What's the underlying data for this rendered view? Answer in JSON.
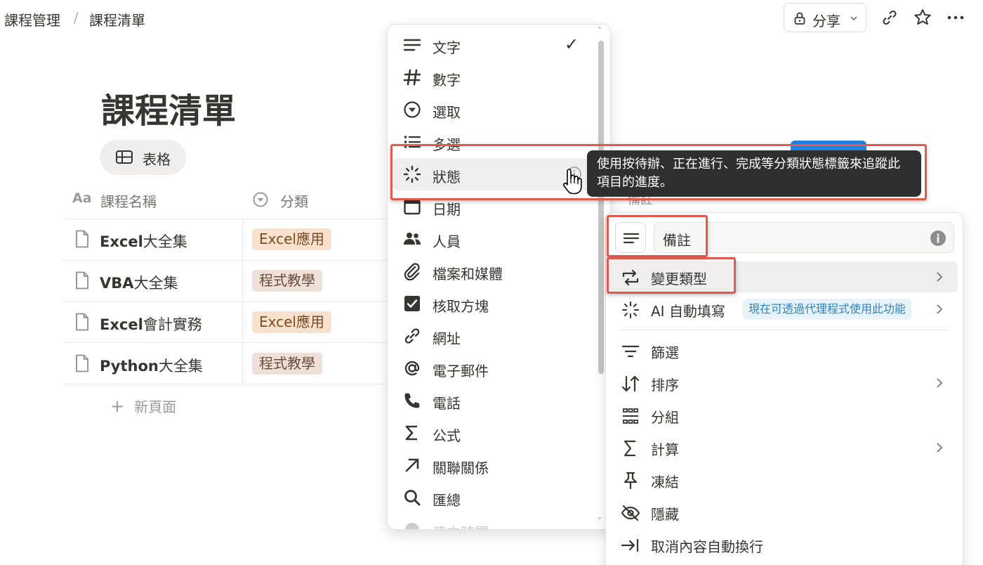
{
  "breadcrumb": {
    "parent": "課程管理",
    "separator": "/",
    "current": "課程清單"
  },
  "topbar": {
    "share_label": "分享",
    "icons": [
      "lock-icon",
      "chevron-down-icon",
      "link-icon",
      "star-icon",
      "more-icon"
    ]
  },
  "page": {
    "title": "課程清單",
    "view_tab": "表格",
    "columns": {
      "name_icon": "Aa",
      "name": "課程名稱",
      "category": "分類"
    },
    "rows": [
      {
        "name_bold": "Excel",
        "name_rest": "大全集",
        "tag": "Excel應用",
        "tag_color": "#f9e2cd"
      },
      {
        "name_bold": "VBA",
        "name_rest": "大全集",
        "tag": "程式教學",
        "tag_color": "#eee0d8"
      },
      {
        "name_bold": "Excel",
        "name_rest": "會計實務",
        "tag": "Excel應用",
        "tag_color": "#f9e2cd"
      },
      {
        "name_bold": "Python",
        "name_rest": "大全集",
        "tag": "程式教學",
        "tag_color": "#eee0d8"
      }
    ],
    "new_page": "新頁面",
    "peek_column_label": "備註"
  },
  "type_menu": {
    "items": [
      {
        "label": "文字",
        "icon": "text-icon",
        "checked": true
      },
      {
        "label": "數字",
        "icon": "number-icon"
      },
      {
        "label": "選取",
        "icon": "select-icon"
      },
      {
        "label": "多選",
        "icon": "multi-select-icon"
      },
      {
        "label": "狀態",
        "icon": "status-icon",
        "hovered": true
      },
      {
        "label": "日期",
        "icon": "calendar-icon"
      },
      {
        "label": "人員",
        "icon": "people-icon"
      },
      {
        "label": "檔案和媒體",
        "icon": "paperclip-icon"
      },
      {
        "label": "核取方塊",
        "icon": "checkbox-icon"
      },
      {
        "label": "網址",
        "icon": "link-icon"
      },
      {
        "label": "電子郵件",
        "icon": "at-icon"
      },
      {
        "label": "電話",
        "icon": "phone-icon"
      },
      {
        "label": "公式",
        "icon": "sigma-icon"
      },
      {
        "label": "關聯關係",
        "icon": "arrow-up-right-icon"
      },
      {
        "label": "匯總",
        "icon": "search-icon"
      },
      {
        "label": "建立時間",
        "icon": "clock-icon"
      }
    ],
    "checkmark": "✓"
  },
  "tooltip": {
    "text": "使用按待辦、正在進行、完成等分類狀態標籤來追蹤此項目的進度。"
  },
  "property_menu": {
    "name_value": "備註",
    "items": {
      "change_type": "變更類型",
      "ai_autofill": "AI 自動填寫",
      "ai_badge": "現在可透過代理程式使用此功能",
      "filter": "篩選",
      "sort": "排序",
      "group": "分組",
      "calculate": "計算",
      "freeze": "凍結",
      "hide": "隱藏",
      "unwrap": "取消內容自動換行"
    }
  },
  "colors": {
    "highlight_red": "#e05a50",
    "tooltip_bg": "#2f2f2f",
    "badge_blue": "#2f83c3"
  }
}
